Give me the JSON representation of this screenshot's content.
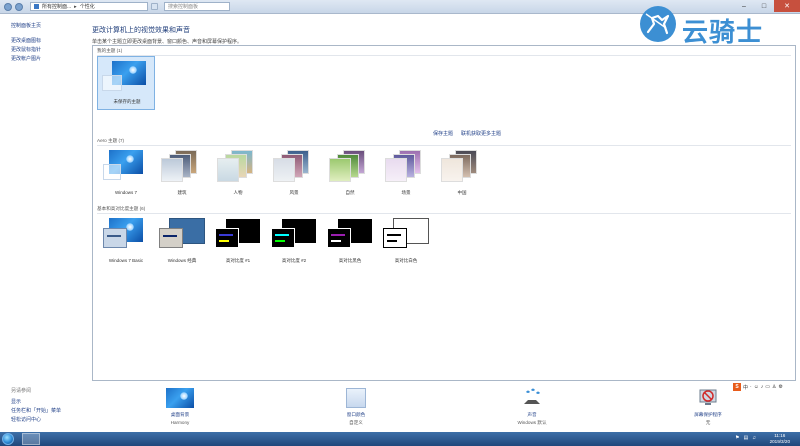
{
  "addressbar": {
    "crumb1": "所有控制面...",
    "crumb2": "个性化",
    "search_placeholder": "搜索控制面板"
  },
  "window_controls": {
    "minimize": "–",
    "maximize": "□",
    "close": "✕"
  },
  "left_pane": {
    "home": "控制面板主页",
    "links": [
      "更改桌面图标",
      "更改鼠标指针",
      "更改帐户图片"
    ],
    "see_also_title": "另请参阅",
    "see_also": [
      "显示",
      "任务栏和「开始」菜单",
      "轻松访问中心"
    ]
  },
  "main": {
    "heading": "更改计算机上的视觉效果和声音",
    "subheading": "单击某个主题立即更改桌面背景、窗口颜色、声音和屏幕保护程序。",
    "my_themes_title": "我的主题 (1)",
    "my_themes": [
      {
        "label": "未保存的主题"
      }
    ],
    "save_theme": "保存主题",
    "get_more_themes": "联机获取更多主题",
    "aero_title": "Aero 主题 (7)",
    "aero_themes": [
      {
        "label": "Windows 7"
      },
      {
        "label": "建筑"
      },
      {
        "label": "人物"
      },
      {
        "label": "风景"
      },
      {
        "label": "自然"
      },
      {
        "label": "场景"
      },
      {
        "label": "中国"
      }
    ],
    "basic_title": "基本和高对比度主题 (6)",
    "basic_themes": [
      {
        "label": "Windows 7 Basic"
      },
      {
        "label": "Windows 经典"
      },
      {
        "label": "高对比度 #1"
      },
      {
        "label": "高对比度 #2"
      },
      {
        "label": "高对比黑色"
      },
      {
        "label": "高对比白色"
      }
    ]
  },
  "bottom": [
    {
      "title": "桌面背景",
      "value": "Harmony"
    },
    {
      "title": "窗口颜色",
      "value": "自定义"
    },
    {
      "title": "声音",
      "value": "Windows 默认"
    },
    {
      "title": "屏幕保护程序",
      "value": "无"
    }
  ],
  "taskbar": {
    "time": "11:16",
    "date": "2019/3/20"
  },
  "ime": {
    "logo": "S",
    "label": "中"
  },
  "watermark": {
    "text": "云骑士"
  },
  "colors": {
    "link": "#1f3f87",
    "heading": "#1f3d7a",
    "selection": "#d6e8fa",
    "taskbar": "#2a568d"
  }
}
